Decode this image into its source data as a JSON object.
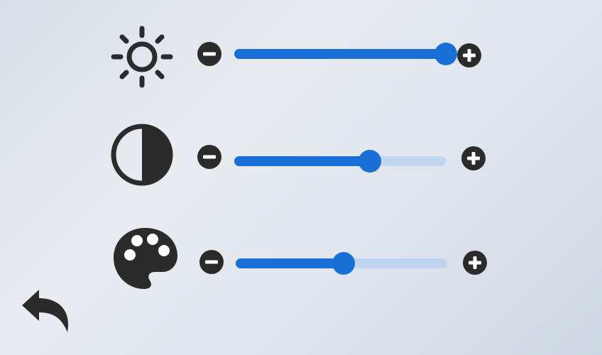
{
  "colors": {
    "accent": "#1a6fd6",
    "icon": "#2b2b2b",
    "track": "#aac8f0"
  },
  "settings": [
    {
      "name": "brightness",
      "icon": "sun-icon",
      "value": 1.0
    },
    {
      "name": "contrast",
      "icon": "half-circle-contrast-icon",
      "value": 0.64
    },
    {
      "name": "color",
      "icon": "palette-icon",
      "value": 0.51
    }
  ],
  "controls": {
    "decrease_icon": "minus-circle-icon",
    "increase_icon": "plus-circle-icon",
    "back_icon": "undo-arrow-icon"
  }
}
